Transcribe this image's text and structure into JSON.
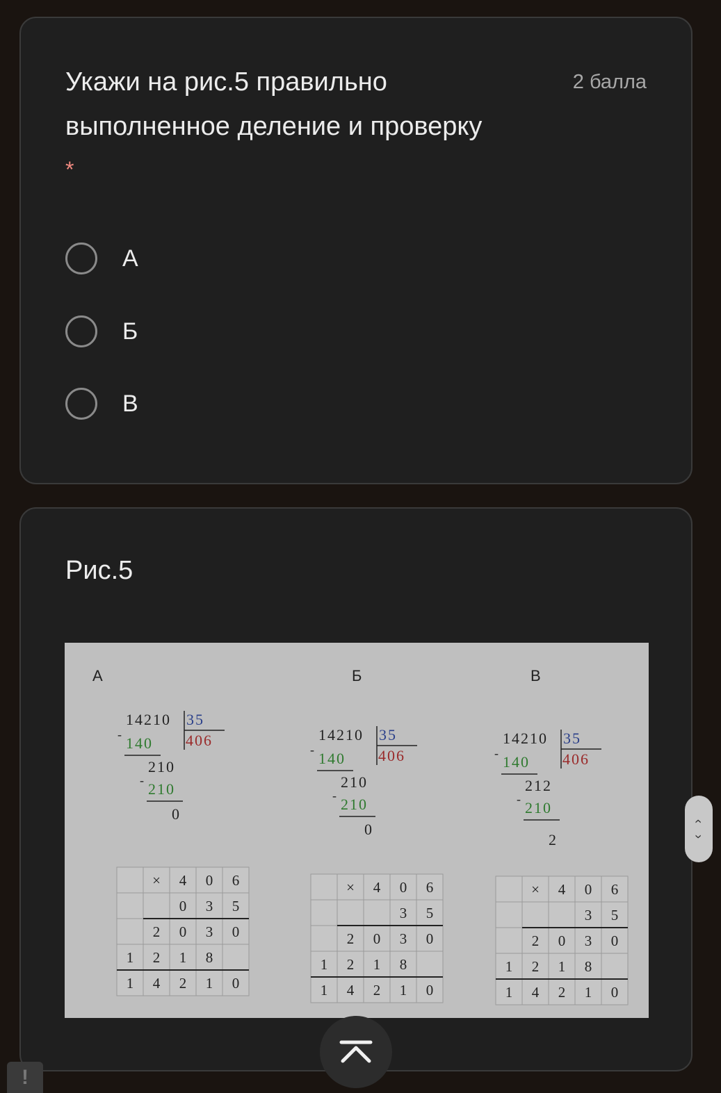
{
  "question": {
    "title": "Укажи на рис.5 правильно выполненное деление и проверку",
    "points": "2 балла",
    "required_mark": "*",
    "options": [
      {
        "label": "А"
      },
      {
        "label": "Б"
      },
      {
        "label": "В"
      }
    ]
  },
  "figure_card": {
    "title": "Рис.5"
  },
  "figure": {
    "panels": [
      {
        "label": "А",
        "division": {
          "dividend": "14210",
          "divisor": "35",
          "quotient": "406",
          "sub1": "140",
          "rem1": "210",
          "sub2": "210",
          "result": "0"
        },
        "check": {
          "rows": [
            [
              "",
              "×",
              "4",
              "0",
              "6"
            ],
            [
              "",
              "",
              "0",
              "3",
              "5"
            ],
            [
              "",
              "2",
              "0",
              "3",
              "0"
            ],
            [
              "1",
              "2",
              "1",
              "8",
              ""
            ],
            [
              "1",
              "4",
              "2",
              "1",
              "0"
            ]
          ]
        }
      },
      {
        "label": "Б",
        "division": {
          "dividend": "14210",
          "divisor": "35",
          "quotient": "406",
          "sub1": "140",
          "rem1": "210",
          "sub2": "210",
          "result": "0"
        },
        "check": {
          "rows": [
            [
              "",
              "×",
              "4",
              "0",
              "6"
            ],
            [
              "",
              "",
              "",
              "3",
              "5"
            ],
            [
              "",
              "2",
              "0",
              "3",
              "0"
            ],
            [
              "1",
              "2",
              "1",
              "8",
              ""
            ],
            [
              "1",
              "4",
              "2",
              "1",
              "0"
            ]
          ]
        }
      },
      {
        "label": "В",
        "division": {
          "dividend": "14210",
          "divisor": "35",
          "quotient": "406",
          "sub1": "140",
          "rem1": "212",
          "sub2": "210",
          "result": "2"
        },
        "check": {
          "rows": [
            [
              "",
              "×",
              "4",
              "0",
              "6"
            ],
            [
              "",
              "",
              "",
              "3",
              "5"
            ],
            [
              "",
              "2",
              "0",
              "3",
              "0"
            ],
            [
              "1",
              "2",
              "1",
              "8",
              ""
            ],
            [
              "1",
              "4",
              "2",
              "1",
              "0"
            ]
          ]
        }
      }
    ],
    "colors": {
      "dividend": "#222222",
      "divisor": "#2a3f8a",
      "quotient": "#9a2a2a",
      "subtrahend": "#2f7a2f",
      "grid": "#9a9a9a"
    }
  },
  "controls": {
    "scroll_up_glyph": "‹",
    "scroll_down_glyph": "›",
    "alert_glyph": "!"
  }
}
